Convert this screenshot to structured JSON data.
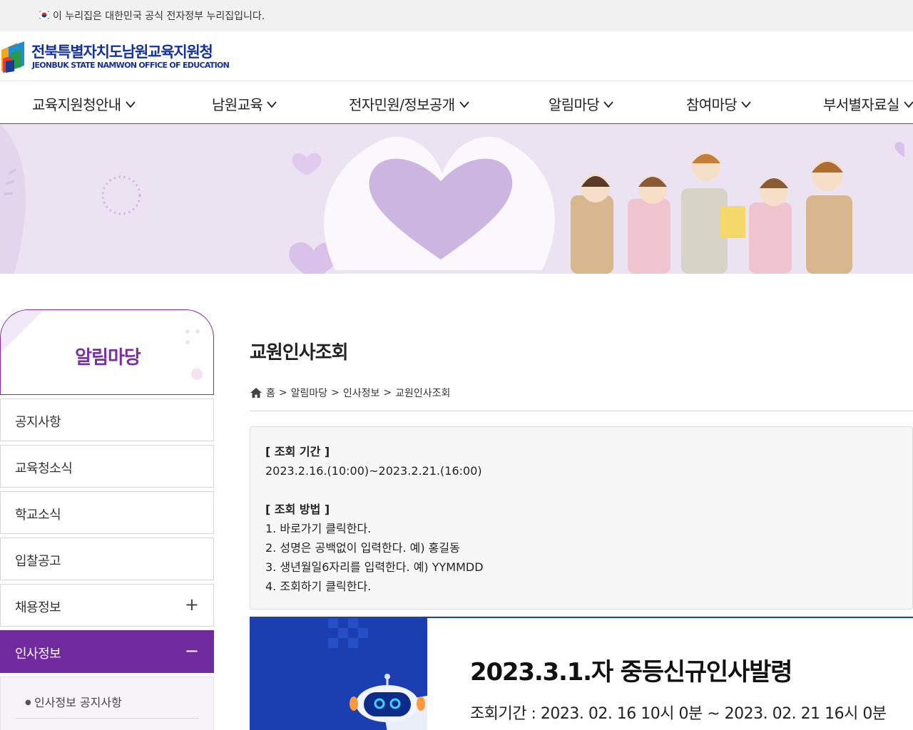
{
  "gov_bar": {
    "flag_icon": "korea-flag-icon",
    "text": "이 누리집은 대한민국 공식 전자정부 누리집입니다."
  },
  "header": {
    "logo_kr": "전북특별자치도남원교육지원청",
    "logo_en": "JEONBUK STATE NAMWON OFFICE OF EDUCATION",
    "brand_color": "#15319a"
  },
  "gnb": {
    "items": [
      {
        "label": "교육지원청안내",
        "icon": "chevron-down-icon"
      },
      {
        "label": "남원교육",
        "icon": "chevron-down-icon"
      },
      {
        "label": "전자민원/정보공개",
        "icon": "chevron-down-icon"
      },
      {
        "label": "알림마당",
        "icon": "chevron-down-icon"
      },
      {
        "label": "참여마당",
        "icon": "chevron-down-icon"
      },
      {
        "label": "부서별자료실",
        "icon": "chevron-down-icon"
      }
    ],
    "accent": "#7b3aa3"
  },
  "lnb": {
    "title": "알림마당",
    "items": [
      {
        "label": "공지사항",
        "sign": ""
      },
      {
        "label": "교육청소식",
        "sign": ""
      },
      {
        "label": "학교소식",
        "sign": ""
      },
      {
        "label": "입찰공고",
        "sign": ""
      },
      {
        "label": "채용정보",
        "sign": "+"
      },
      {
        "label": "인사정보",
        "sign": "−",
        "active": true
      }
    ],
    "sub_items": [
      {
        "label": "인사정보 공지사항"
      }
    ],
    "active_color": "#722a9f"
  },
  "content": {
    "title": "교원인사조회",
    "breadcrumb": [
      "홈",
      "알림마당",
      "인사정보",
      "교원인사조회"
    ],
    "breadcrumb_sep": ">",
    "info": {
      "period_head": "[ 조회 기간 ]",
      "period_value": "2023.2.16.(10:00)~2023.2.21.(16:00)",
      "method_head": "[ 조회 방법 ]",
      "steps": [
        "1. 바로가기 클릭한다.",
        "2. 성명은 공백없이 입력한다. 예) 홍길동",
        "3. 생년월일6자리를 입력한다. 예) YYMMDD",
        "4. 조회하기 클릭한다."
      ]
    },
    "notice": {
      "title": "2023.3.1.자 중등신규인사발령",
      "period": "조회기간 : 2023. 02. 16 10시 0분 ~ 2023. 02. 21 16시 0분",
      "thumb_color": "#1b3fb0"
    }
  }
}
